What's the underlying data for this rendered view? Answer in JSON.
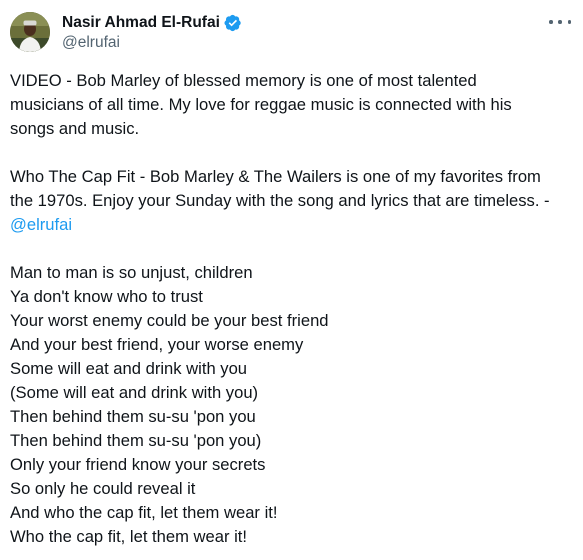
{
  "author": {
    "display_name": "Nasir Ahmad El-Rufai",
    "handle": "@elrufai",
    "verified": true,
    "avatar_icon": "profile-photo",
    "verified_icon": "verified-badge-icon",
    "more_icon": "more-options-icon"
  },
  "colors": {
    "text": "#0f1419",
    "secondary": "#536471",
    "link": "#1d9bf0",
    "verified": "#1d9bf0"
  },
  "tweet": {
    "para1": [
      "VIDEO - Bob Marley of blessed memory is one of most talented",
      "musicians of all time. My love for reggae music is connected with his",
      "songs and music."
    ],
    "para2": [
      "Who The Cap Fit - Bob Marley & The Wailers is one of my favorites from",
      "the 1970s. Enjoy your Sunday with the song and lyrics that are timeless. -"
    ],
    "mention": "@elrufai",
    "lyrics": [
      "Man to man is so unjust, children",
      "Ya don't know who to trust",
      "Your worst enemy could be your best friend",
      "And your best friend, your worse enemy",
      "Some will eat and drink with you",
      "(Some will eat and drink with you)",
      "Then behind them su-su 'pon you",
      "Then behind them su-su 'pon you)",
      "Only your friend know your secrets",
      "So only he could reveal it",
      "And who the cap fit, let them wear it!",
      "Who the cap fit, let them wear it!"
    ]
  }
}
